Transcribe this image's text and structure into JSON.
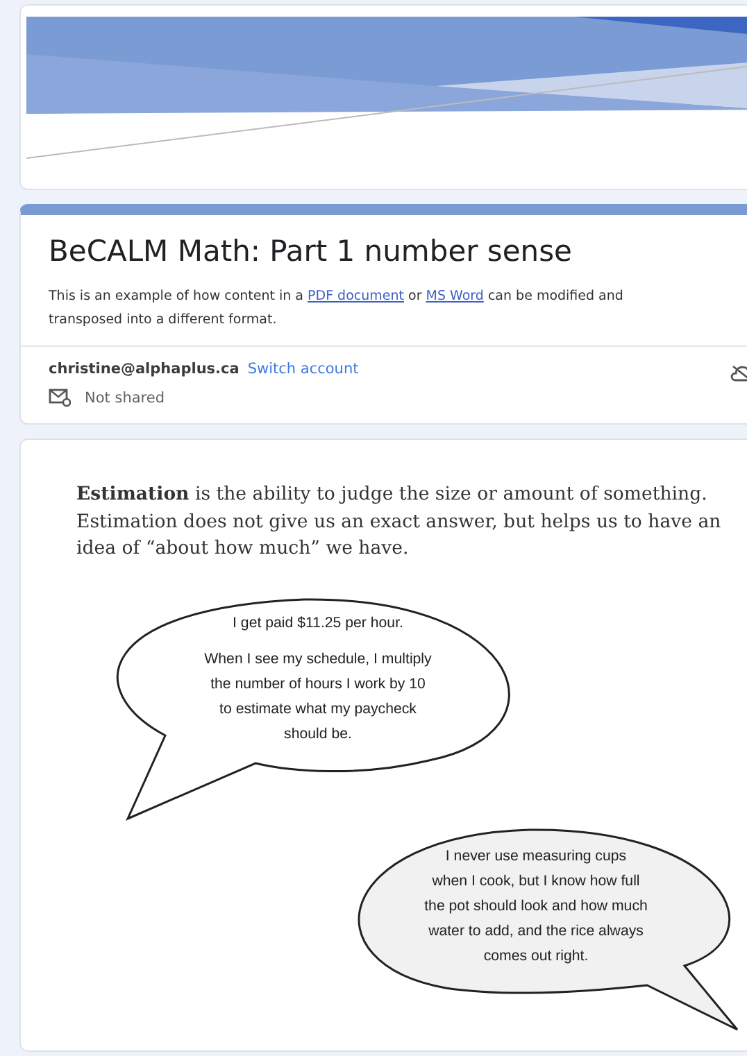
{
  "form": {
    "title": "BeCALM Math: Part 1 number sense",
    "description": [
      {
        "kind": "text",
        "text": "This is an example of how content in a "
      },
      {
        "kind": "link",
        "text": "PDF document"
      },
      {
        "kind": "text",
        "text": " or "
      },
      {
        "kind": "link",
        "text": "MS Word"
      },
      {
        "kind": "text",
        "text": " can be modified and transposed into a different format."
      }
    ],
    "account": {
      "email": "christine@alphaplus.ca",
      "switch_link": "Switch account",
      "sharing": "Not shared"
    }
  },
  "content": {
    "intro": "**Estimation** is the ability to judge the size or amount of something. Estimation does not give us an exact answer, but helps us to have an idea of “about how much” we have.",
    "bubbles": [
      {
        "kind": "left",
        "paragraphs": [
          [
            "I get paid $11.25 per hour."
          ],
          [
            "When I see my schedule, I multiply",
            "the number of hours I work by 10",
            "to estimate what my paycheck",
            "should be."
          ]
        ]
      },
      {
        "kind": "right",
        "paragraphs": [
          [
            "I never use measuring cups",
            "when I cook, but I know how full",
            "the pot should look and how much",
            "water to add, and the rice always",
            "comes out right."
          ]
        ]
      }
    ]
  }
}
